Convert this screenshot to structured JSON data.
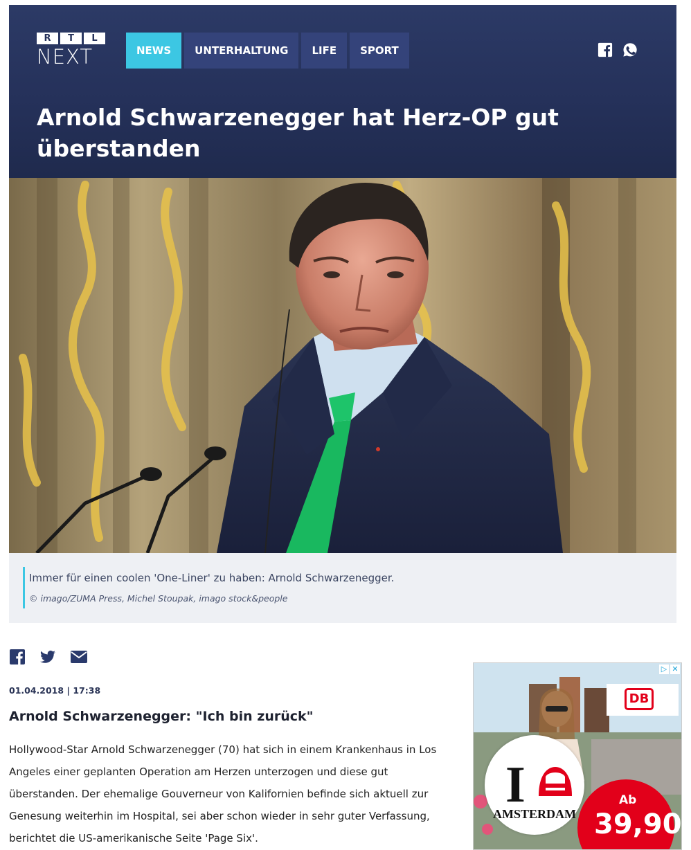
{
  "header": {
    "logo_top_letters": [
      "R",
      "T",
      "L"
    ],
    "logo_bottom": "NEXT",
    "nav": [
      {
        "label": "NEWS",
        "active": true
      },
      {
        "label": "UNTERHALTUNG",
        "active": false
      },
      {
        "label": "LIFE",
        "active": false
      },
      {
        "label": "SPORT",
        "active": false
      }
    ],
    "social_icons": [
      "facebook-icon",
      "whatsapp-icon"
    ],
    "headline": "Arnold Schwarzenegger hat Herz-OP gut überstanden"
  },
  "caption": {
    "text": "Immer für einen coolen 'One-Liner' zu haben: Arnold Schwarzenegger.",
    "credit": "© imago/ZUMA Press, Michel Stoupak, imago stock&people"
  },
  "share_icons": [
    "facebook-icon",
    "twitter-icon",
    "mail-icon"
  ],
  "article": {
    "date": "01.04.2018 | 17:38",
    "subhead": "Arnold Schwarzenegger: \"Ich bin zurück\"",
    "body": "Hollywood-Star Arnold Schwarzenegger (70) hat sich in einem Krankenhaus in Los Angeles einer geplanten Operation am Herzen unterzogen und diese gut überstanden. Der ehemalige Gouverneur von Kalifornien befinde sich aktuell zur Genesung weiterhin im Hospital, sei aber schon wieder in sehr guter Verfassung, berichtet die US-amerikanische Seite 'Page Six'."
  },
  "ad": {
    "marker_icons": [
      "adchoices-icon",
      "close-icon"
    ],
    "brand": "DB",
    "big_letter": "I",
    "city": "AMSTERDAM",
    "price_prefix": "Ab",
    "price": "39,90"
  },
  "colors": {
    "header_bg": "#25315a",
    "nav_active": "#3cc7e3",
    "nav_bg": "#34437a",
    "caption_bg": "#eef0f4",
    "db_red": "#e2001a"
  }
}
